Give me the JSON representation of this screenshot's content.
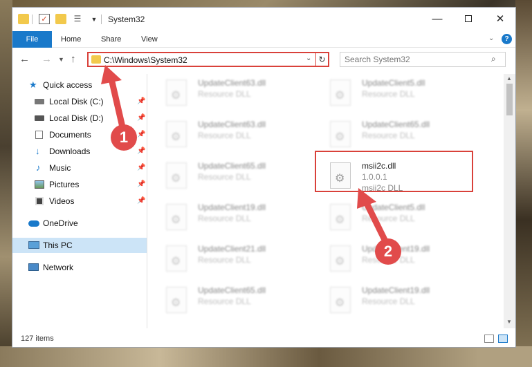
{
  "window": {
    "title": "System32"
  },
  "ribbon": {
    "file": "File",
    "home": "Home",
    "share": "Share",
    "view": "View",
    "help": "?"
  },
  "nav": {
    "address": "C:\\Windows\\System32",
    "search_placeholder": "Search System32"
  },
  "sidebar": {
    "items": [
      {
        "label": "Quick access",
        "icon": "star-icon",
        "pinned": false
      },
      {
        "label": "Local Disk (C:)",
        "icon": "drive-icon",
        "pinned": true
      },
      {
        "label": "Local Disk (D:)",
        "icon": "drive-icon",
        "pinned": true
      },
      {
        "label": "Documents",
        "icon": "documents-icon",
        "pinned": true
      },
      {
        "label": "Downloads",
        "icon": "download-icon",
        "pinned": true
      },
      {
        "label": "Music",
        "icon": "music-icon",
        "pinned": true
      },
      {
        "label": "Pictures",
        "icon": "pictures-icon",
        "pinned": true
      },
      {
        "label": "Videos",
        "icon": "videos-icon",
        "pinned": true
      },
      {
        "label": "OneDrive",
        "icon": "cloud-icon",
        "pinned": false
      },
      {
        "label": "This PC",
        "icon": "computer-icon",
        "pinned": false,
        "selected": true
      },
      {
        "label": "Network",
        "icon": "network-icon",
        "pinned": false
      }
    ]
  },
  "files": {
    "left": [
      {
        "name": "UpdateClient63.dll",
        "type": "Resource DLL"
      },
      {
        "name": "UpdateClient63.dll",
        "type": "Resource DLL"
      },
      {
        "name": "UpdateClient65.dll",
        "type": "Resource DLL"
      },
      {
        "name": "UpdateClient19.dll",
        "type": "Resource DLL"
      },
      {
        "name": "UpdateClient21.dll",
        "type": "Resource DLL"
      },
      {
        "name": "UpdateClient65.dll",
        "type": "Resource DLL"
      }
    ],
    "right": [
      {
        "name": "UpdateClient5.dll",
        "type": "Resource DLL"
      },
      {
        "name": "UpdateClient65.dll",
        "type": "Resource DLL"
      },
      {
        "name": "UpdateClient5.dll",
        "type": "Resource DLL"
      },
      {
        "name": "UpdateClient19.dll",
        "type": "Resource DLL"
      },
      {
        "name": "UpdateClient19.dll",
        "type": "Resource DLL"
      }
    ],
    "highlighted": {
      "name": "msii2c.dll",
      "version": "1.0.0.1",
      "type": "msii2c DLL"
    }
  },
  "status": {
    "count": "127 items"
  },
  "callouts": {
    "one": "1",
    "two": "2"
  },
  "colors": {
    "accent": "#1979ca",
    "highlight": "#d9413a"
  }
}
